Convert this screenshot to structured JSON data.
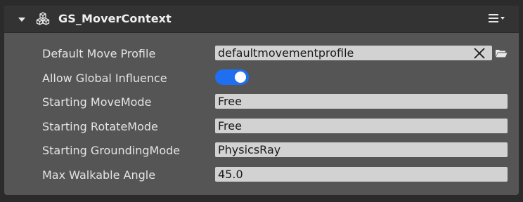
{
  "component": {
    "title": "GS_MoverContext",
    "icon": "cube-cluster-icon",
    "menu_icon": "hamburger-menu-icon"
  },
  "properties": {
    "default_move_profile": {
      "label": "Default Move Profile",
      "value": "defaultmovementprofile"
    },
    "allow_global_influence": {
      "label": "Allow Global Influence",
      "enabled": true
    },
    "starting_move_mode": {
      "label": "Starting MoveMode",
      "value": "Free"
    },
    "starting_rotate_mode": {
      "label": "Starting RotateMode",
      "value": "Free"
    },
    "starting_grounding_mode": {
      "label": "Starting GroundingMode",
      "value": "PhysicsRay"
    },
    "max_walkable_angle": {
      "label": "Max Walkable Angle",
      "value": "45.0"
    }
  },
  "colors": {
    "panel_bg": "#555555",
    "header_bg": "#333333",
    "field_bg": "#d2d2d2",
    "toggle_on": "#1f6ff0"
  }
}
